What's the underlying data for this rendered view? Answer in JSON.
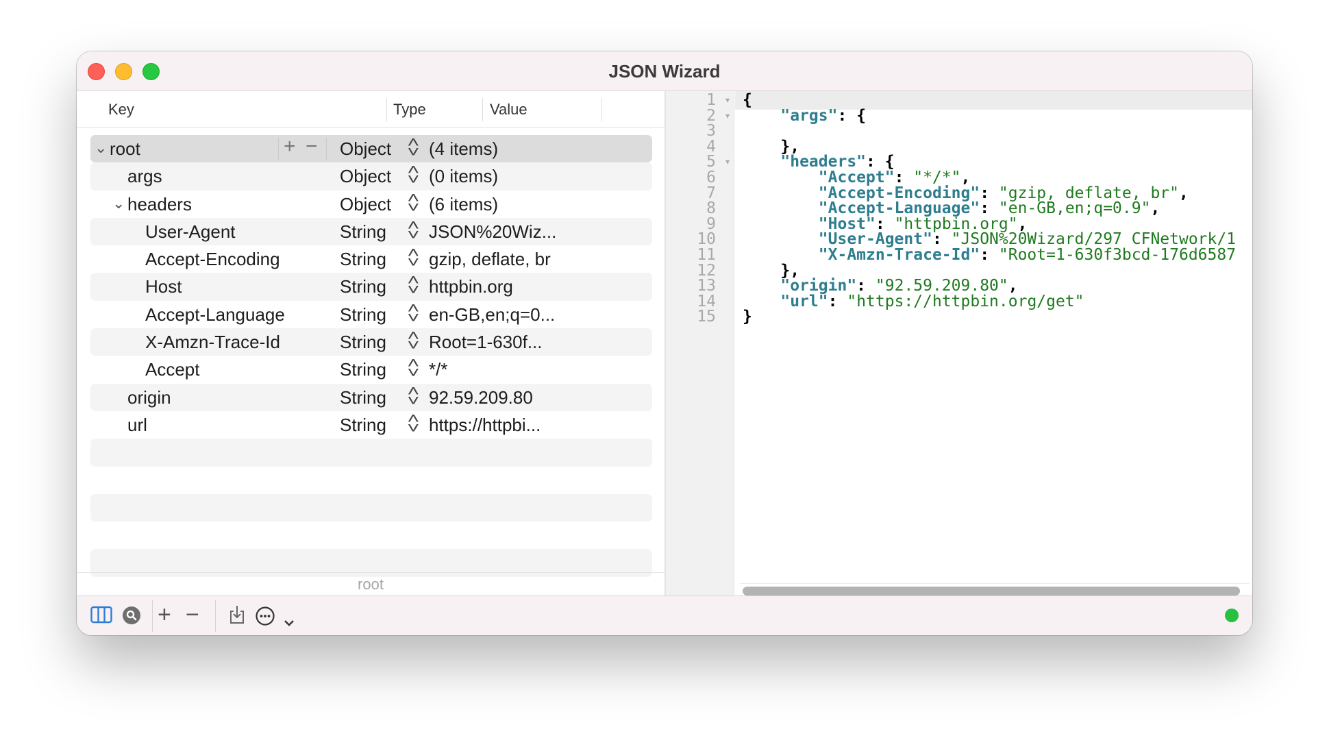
{
  "window": {
    "title": "JSON Wizard"
  },
  "columns": {
    "key": "Key",
    "type": "Type",
    "value": "Value"
  },
  "tree": [
    {
      "key": "root",
      "type": "Object",
      "value": "(4 items)",
      "expanded": true
    },
    {
      "key": "args",
      "type": "Object",
      "value": "(0 items)"
    },
    {
      "key": "headers",
      "type": "Object",
      "value": "(6 items)",
      "expanded": true
    },
    {
      "key": "User-Agent",
      "type": "String",
      "value": "JSON%20Wiz..."
    },
    {
      "key": "Accept-Encoding",
      "type": "String",
      "value": "gzip, deflate, br"
    },
    {
      "key": "Host",
      "type": "String",
      "value": "httpbin.org"
    },
    {
      "key": "Accept-Language",
      "type": "String",
      "value": "en-GB,en;q=0..."
    },
    {
      "key": "X-Amzn-Trace-Id",
      "type": "String",
      "value": "Root=1-630f..."
    },
    {
      "key": "Accept",
      "type": "String",
      "value": "*/*"
    },
    {
      "key": "origin",
      "type": "String",
      "value": "92.59.209.80"
    },
    {
      "key": "url",
      "type": "String",
      "value": "https://httpbi..."
    }
  ],
  "row_controls": {
    "add": "+",
    "remove": "−"
  },
  "pathbar": "root",
  "editor": {
    "line_numbers": [
      "1",
      "2",
      "3",
      "4",
      "5",
      "6",
      "7",
      "8",
      "9",
      "10",
      "11",
      "12",
      "13",
      "14",
      "15"
    ],
    "lines": [
      {
        "indent": "",
        "key": "",
        "sep": "",
        "value": "",
        "tail": "{"
      },
      {
        "indent": "    ",
        "key": "\"args\"",
        "sep": ": ",
        "value": "",
        "tail": "{"
      },
      {
        "indent": "",
        "key": "",
        "sep": "",
        "value": "",
        "tail": ""
      },
      {
        "indent": "    ",
        "key": "",
        "sep": "",
        "value": "",
        "tail": "},"
      },
      {
        "indent": "    ",
        "key": "\"headers\"",
        "sep": ": ",
        "value": "",
        "tail": "{"
      },
      {
        "indent": "        ",
        "key": "\"Accept\"",
        "sep": ": ",
        "value": "\"*/*\"",
        "tail": ","
      },
      {
        "indent": "        ",
        "key": "\"Accept-Encoding\"",
        "sep": ": ",
        "value": "\"gzip, deflate, br\"",
        "tail": ","
      },
      {
        "indent": "        ",
        "key": "\"Accept-Language\"",
        "sep": ": ",
        "value": "\"en-GB,en;q=0.9\"",
        "tail": ","
      },
      {
        "indent": "        ",
        "key": "\"Host\"",
        "sep": ": ",
        "value": "\"httpbin.org\"",
        "tail": ","
      },
      {
        "indent": "        ",
        "key": "\"User-Agent\"",
        "sep": ": ",
        "value": "\"JSON%20Wizard/297 CFNetwork/1",
        "tail": ""
      },
      {
        "indent": "        ",
        "key": "\"X-Amzn-Trace-Id\"",
        "sep": ": ",
        "value": "\"Root=1-630f3bcd-176d6587",
        "tail": ""
      },
      {
        "indent": "    ",
        "key": "",
        "sep": "",
        "value": "",
        "tail": "},"
      },
      {
        "indent": "    ",
        "key": "\"origin\"",
        "sep": ": ",
        "value": "\"92.59.209.80\"",
        "tail": ","
      },
      {
        "indent": "    ",
        "key": "\"url\"",
        "sep": ": ",
        "value": "\"https://httpbin.org/get\"",
        "tail": ""
      },
      {
        "indent": "",
        "key": "",
        "sep": "",
        "value": "",
        "tail": "}"
      }
    ]
  },
  "toolbar": {
    "icons": [
      "columns-icon",
      "search-icon",
      "add-icon",
      "remove-icon",
      "import-icon",
      "more-icon",
      "chevron-down-icon"
    ],
    "status_color": "#27c140"
  },
  "colors": {
    "selection": "#dcdcdd",
    "json_key": "#2e7e8f",
    "json_string": "#1f7a1f"
  }
}
